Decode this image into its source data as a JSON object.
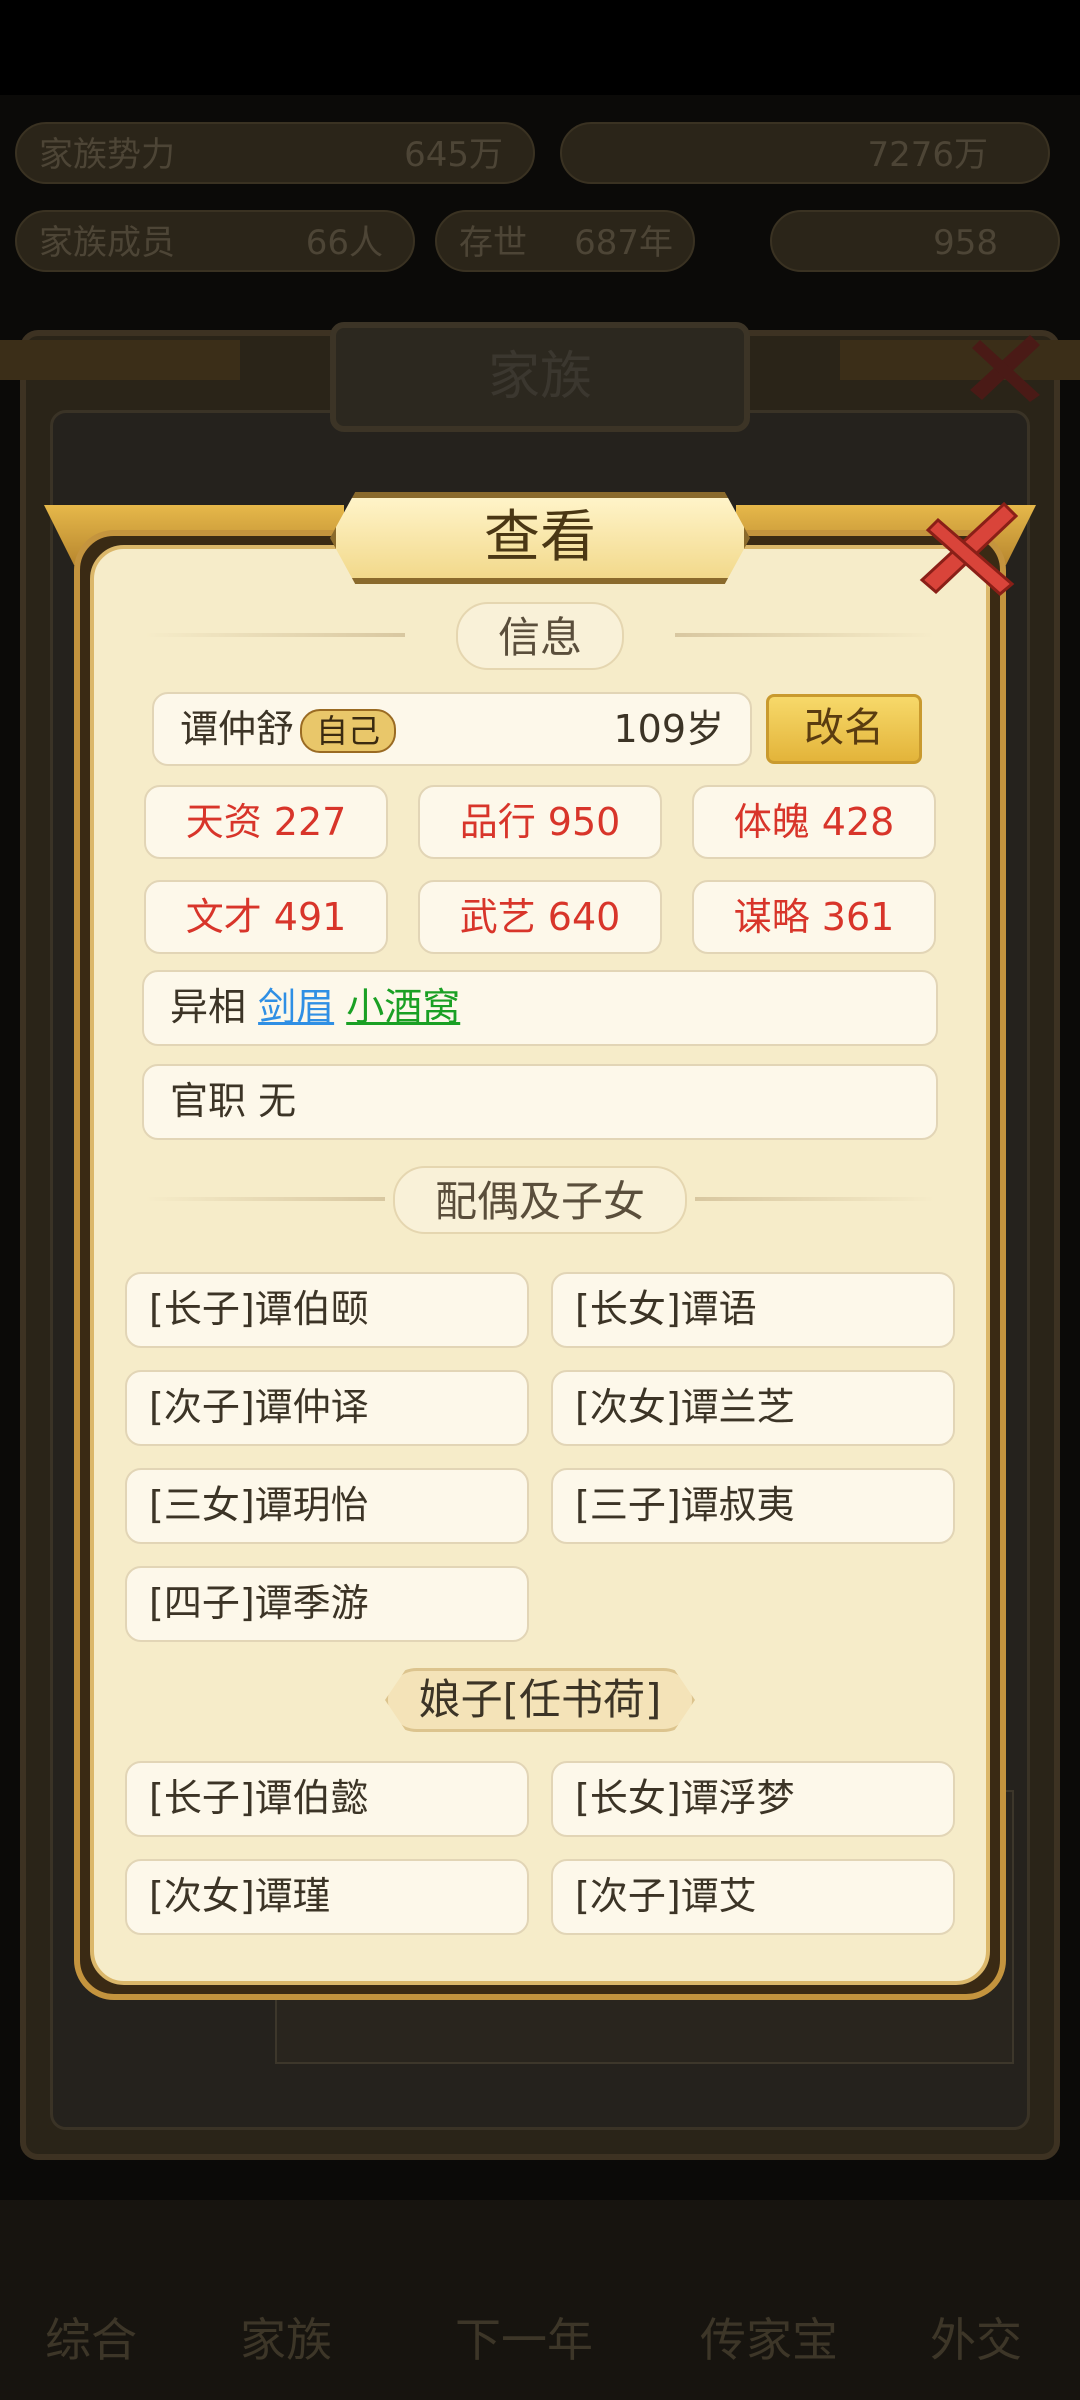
{
  "background": {
    "top_stats": [
      "家族势力",
      "645万",
      "7276万",
      "家族成员",
      "66人",
      "存世",
      "687年",
      "958"
    ],
    "family_window_title": "家族",
    "bottom_nav": [
      "综合",
      "家族",
      "下一年",
      "传家宝",
      "外交"
    ]
  },
  "dialog": {
    "title": "查看",
    "info_header": "信息",
    "member": {
      "name": "谭仲舒",
      "tag": "自己",
      "age": "109岁",
      "rename_label": "改名"
    },
    "attributes": [
      {
        "label": "天资 227"
      },
      {
        "label": "品行 950"
      },
      {
        "label": "体魄 428"
      },
      {
        "label": "文才 491"
      },
      {
        "label": "武艺 640"
      },
      {
        "label": "谋略 361"
      }
    ],
    "traits_label": "异相",
    "traits": [
      "剑眉",
      "小酒窝"
    ],
    "official_label": "官职 无",
    "family_header": "配偶及子女",
    "children_group1": [
      "[长子]谭伯颐",
      "[长女]谭语",
      "[次子]谭仲译",
      "[次女]谭兰芝",
      "[三女]谭玥怡",
      "[三子]谭叔夷",
      "[四子]谭季游"
    ],
    "spouse_label": "娘子[任书荷]",
    "children_group2": [
      "[长子]谭伯懿",
      "[长女]谭浮梦",
      "[次女]谭瑾",
      "[次子]谭艾"
    ]
  },
  "colors": {
    "attribute_text": "#d8352a",
    "trait_1": "#2f8fe4",
    "trait_2": "#1aa024",
    "panel_bg": "#f6ecc9",
    "gold_accent": "#e3b43a"
  }
}
